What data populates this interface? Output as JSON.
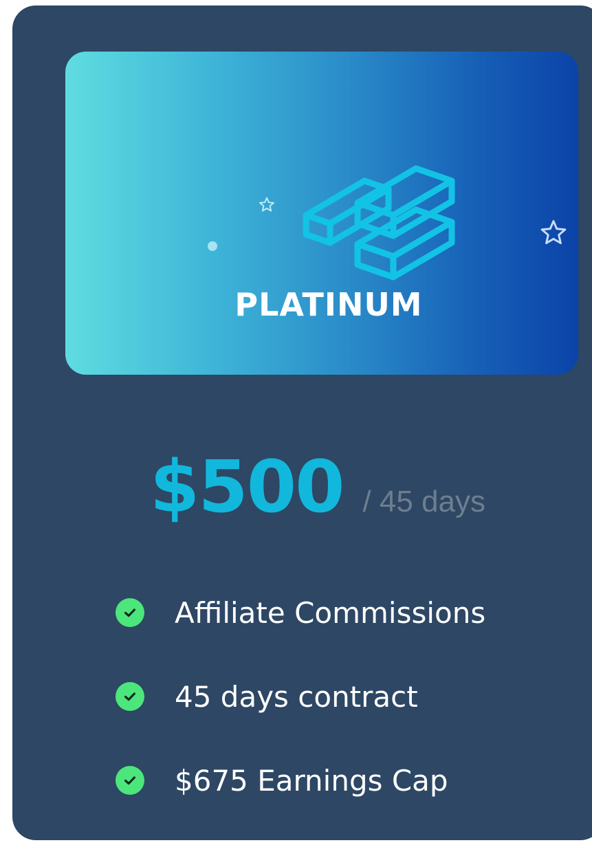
{
  "plan": {
    "name": "PLATINUM",
    "price": "$500",
    "period": "/ 45 days",
    "icon": "gold-bars-icon"
  },
  "features": [
    {
      "label": "Affiliate Commissions",
      "icon": "check-icon"
    },
    {
      "label": "45 days contract",
      "icon": "check-icon"
    },
    {
      "label": "$675 Earnings Cap",
      "icon": "check-icon"
    }
  ],
  "colors": {
    "card_background": "#2d4764",
    "banner_gradient_start": "#5fdce0",
    "banner_gradient_end": "#0b43a8",
    "price": "#12b7dc",
    "period": "#6e7e8f",
    "check": "#4ce67c",
    "icon": "#12c3e6"
  }
}
